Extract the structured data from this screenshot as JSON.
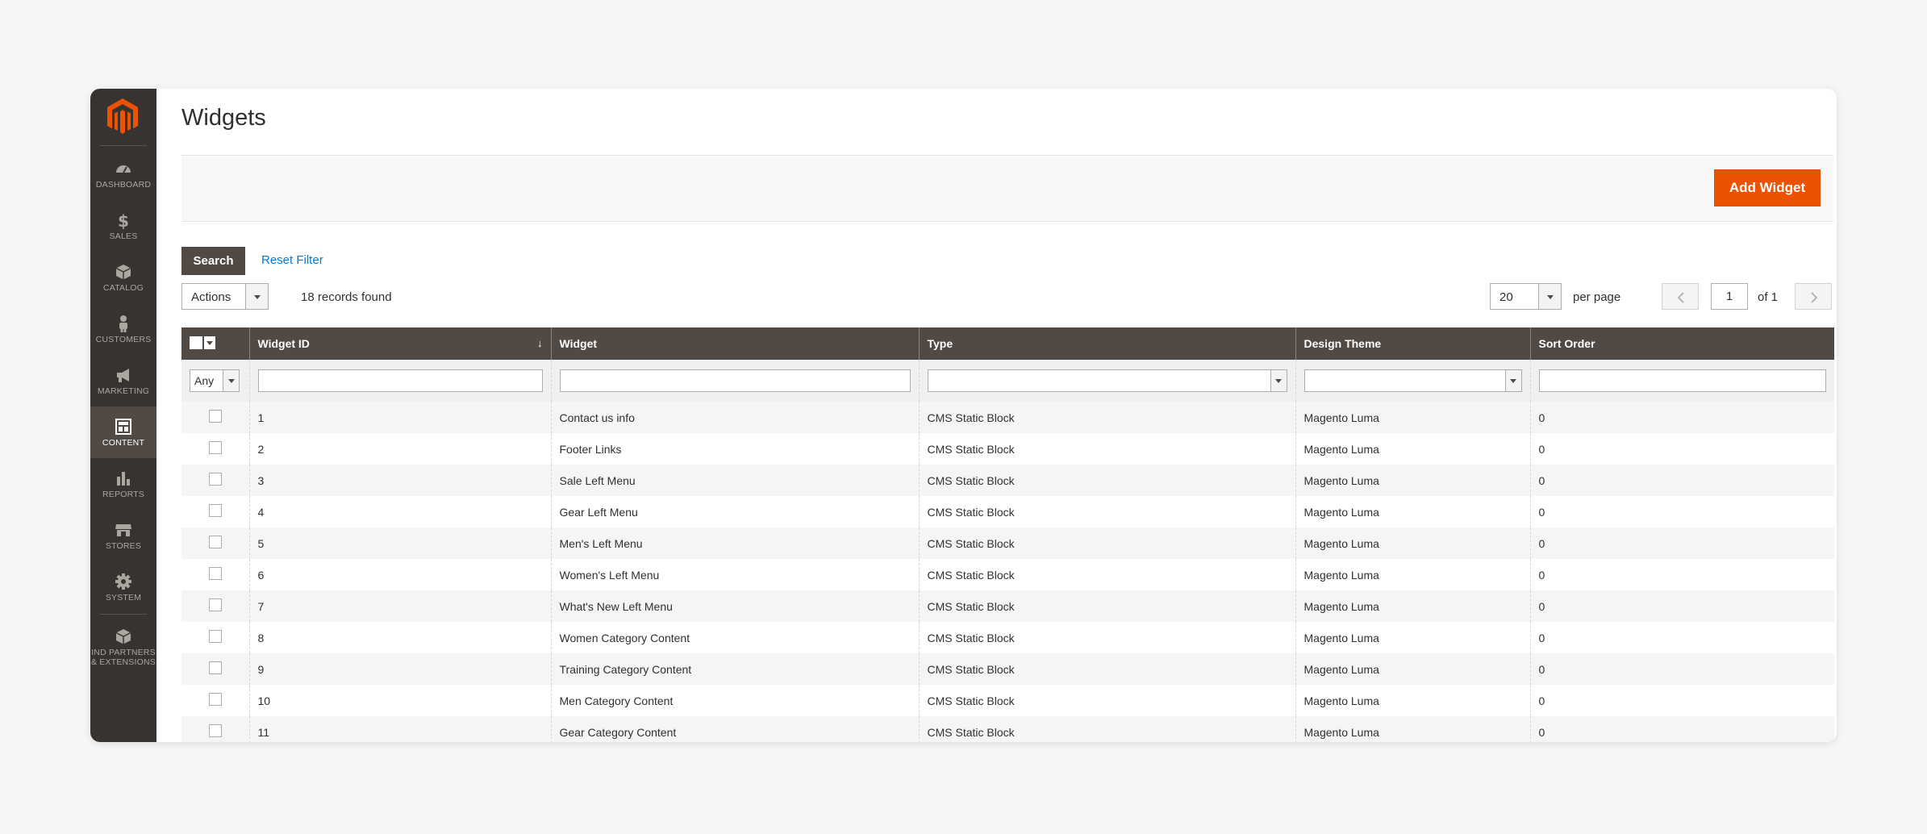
{
  "sidebar": {
    "items": [
      {
        "label": "DASHBOARD",
        "icon": "dashboard-icon"
      },
      {
        "label": "SALES",
        "icon": "dollar-icon"
      },
      {
        "label": "CATALOG",
        "icon": "box-icon"
      },
      {
        "label": "CUSTOMERS",
        "icon": "person-icon"
      },
      {
        "label": "MARKETING",
        "icon": "megaphone-icon"
      },
      {
        "label": "CONTENT",
        "icon": "content-layout-icon",
        "active": true
      },
      {
        "label": "REPORTS",
        "icon": "bar-chart-icon"
      },
      {
        "label": "STORES",
        "icon": "store-icon"
      },
      {
        "label": "SYSTEM",
        "icon": "gear-icon"
      },
      {
        "label_line1": "IND PARTNERS",
        "label_line2": "& EXTENSIONS",
        "icon": "partners-box-icon"
      }
    ]
  },
  "page": {
    "title": "Widgets"
  },
  "toolbar": {
    "add_label": "Add Widget"
  },
  "filters": {
    "search_label": "Search",
    "reset_label": "Reset Filter"
  },
  "massaction": {
    "actions_label": "Actions",
    "records_found": "18 records found"
  },
  "pager": {
    "per_page_value": "20",
    "per_page_label": "per page",
    "page_value": "1",
    "of_label": "of 1"
  },
  "grid": {
    "headers": [
      "Widget ID",
      "Widget",
      "Type",
      "Design Theme",
      "Sort Order"
    ],
    "any_label": "Any",
    "rows": [
      {
        "id": "1",
        "widget": "Contact us info",
        "type": "CMS Static Block",
        "theme": "Magento Luma",
        "sort": "0"
      },
      {
        "id": "2",
        "widget": "Footer Links",
        "type": "CMS Static Block",
        "theme": "Magento Luma",
        "sort": "0"
      },
      {
        "id": "3",
        "widget": "Sale Left Menu",
        "type": "CMS Static Block",
        "theme": "Magento Luma",
        "sort": "0"
      },
      {
        "id": "4",
        "widget": "Gear Left Menu",
        "type": "CMS Static Block",
        "theme": "Magento Luma",
        "sort": "0"
      },
      {
        "id": "5",
        "widget": "Men's Left Menu",
        "type": "CMS Static Block",
        "theme": "Magento Luma",
        "sort": "0"
      },
      {
        "id": "6",
        "widget": "Women's Left Menu",
        "type": "CMS Static Block",
        "theme": "Magento Luma",
        "sort": "0"
      },
      {
        "id": "7",
        "widget": "What's New Left Menu",
        "type": "CMS Static Block",
        "theme": "Magento Luma",
        "sort": "0"
      },
      {
        "id": "8",
        "widget": "Women Category Content",
        "type": "CMS Static Block",
        "theme": "Magento Luma",
        "sort": "0"
      },
      {
        "id": "9",
        "widget": "Training Category Content",
        "type": "CMS Static Block",
        "theme": "Magento Luma",
        "sort": "0"
      },
      {
        "id": "10",
        "widget": "Men Category Content",
        "type": "CMS Static Block",
        "theme": "Magento Luma",
        "sort": "0"
      },
      {
        "id": "11",
        "widget": "Gear Category Content",
        "type": "CMS Static Block",
        "theme": "Magento Luma",
        "sort": "0"
      }
    ]
  },
  "colors": {
    "accent": "#eb5202",
    "sidebar": "#373330",
    "header": "#514943",
    "link": "#007bdb"
  }
}
